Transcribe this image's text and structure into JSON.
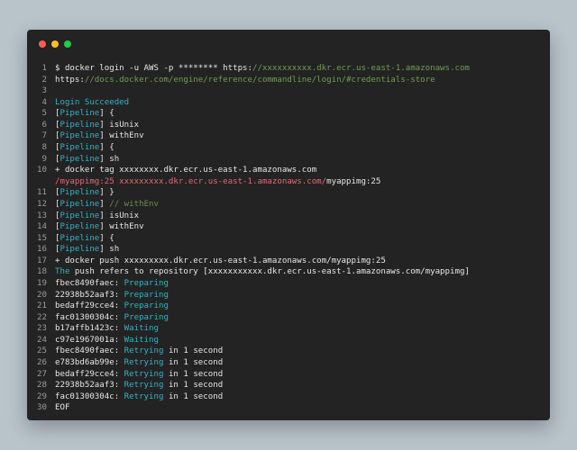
{
  "colors": {
    "background": "#b9c3ca",
    "window": "#232323",
    "close": "#ff5f57",
    "minimize": "#febc2e",
    "maximize": "#28c840",
    "default_text": "#e6e6e6",
    "line_number": "#9c9c9c",
    "cyan": "#33b3c8",
    "green_url": "#6f9f4f",
    "red_url": "#e06c75",
    "comment": "#6a8f53"
  },
  "window": {
    "buttons": [
      "close",
      "minimize",
      "maximize"
    ]
  },
  "lines": [
    {
      "n": "1",
      "segments": [
        {
          "t": "$ docker login -u AWS -p ******** https:",
          "c": "#e6e6e6"
        },
        {
          "t": "//xxxxxxxxxx.dkr.ecr.us-east-1.amazonaws.com",
          "c": "#6f9f4f"
        }
      ]
    },
    {
      "n": "2",
      "segments": [
        {
          "t": "https:",
          "c": "#e6e6e6"
        },
        {
          "t": "//docs.docker.com/engine/reference/commandline/login/#credentials-store",
          "c": "#6f9f4f"
        }
      ]
    },
    {
      "n": "3",
      "segments": []
    },
    {
      "n": "4",
      "segments": [
        {
          "t": "Login Succeeded",
          "c": "#33b3c8"
        }
      ]
    },
    {
      "n": "5",
      "segments": [
        {
          "t": "[",
          "c": "#e6e6e6"
        },
        {
          "t": "Pipeline",
          "c": "#33b3c8"
        },
        {
          "t": "] {",
          "c": "#e6e6e6"
        }
      ]
    },
    {
      "n": "6",
      "segments": [
        {
          "t": "[",
          "c": "#e6e6e6"
        },
        {
          "t": "Pipeline",
          "c": "#33b3c8"
        },
        {
          "t": "] isUnix",
          "c": "#e6e6e6"
        }
      ]
    },
    {
      "n": "7",
      "segments": [
        {
          "t": "[",
          "c": "#e6e6e6"
        },
        {
          "t": "Pipeline",
          "c": "#33b3c8"
        },
        {
          "t": "] withEnv",
          "c": "#e6e6e6"
        }
      ]
    },
    {
      "n": "8",
      "segments": [
        {
          "t": "[",
          "c": "#e6e6e6"
        },
        {
          "t": "Pipeline",
          "c": "#33b3c8"
        },
        {
          "t": "] {",
          "c": "#e6e6e6"
        }
      ]
    },
    {
      "n": "9",
      "segments": [
        {
          "t": "[",
          "c": "#e6e6e6"
        },
        {
          "t": "Pipeline",
          "c": "#33b3c8"
        },
        {
          "t": "] sh",
          "c": "#e6e6e6"
        }
      ]
    },
    {
      "n": "10",
      "segments": [
        {
          "t": "+ docker tag xxxxxxxx.dkr.ecr.us-east-1.amazonaws.com",
          "c": "#e6e6e6"
        }
      ]
    },
    {
      "n": "",
      "segments": [
        {
          "t": "/myappimg:25 xxxxxxxxx.dkr.ecr.us-east-1.amazonaws.com/",
          "c": "#e06c75"
        },
        {
          "t": "myappimg:25",
          "c": "#e6e6e6"
        }
      ]
    },
    {
      "n": "11",
      "segments": [
        {
          "t": "[",
          "c": "#e6e6e6"
        },
        {
          "t": "Pipeline",
          "c": "#33b3c8"
        },
        {
          "t": "] }",
          "c": "#e6e6e6"
        }
      ]
    },
    {
      "n": "12",
      "segments": [
        {
          "t": "[",
          "c": "#e6e6e6"
        },
        {
          "t": "Pipeline",
          "c": "#33b3c8"
        },
        {
          "t": "] ",
          "c": "#e6e6e6"
        },
        {
          "t": "// withEnv",
          "c": "#6a8f53"
        }
      ]
    },
    {
      "n": "13",
      "segments": [
        {
          "t": "[",
          "c": "#e6e6e6"
        },
        {
          "t": "Pipeline",
          "c": "#33b3c8"
        },
        {
          "t": "] isUnix",
          "c": "#e6e6e6"
        }
      ]
    },
    {
      "n": "14",
      "segments": [
        {
          "t": "[",
          "c": "#e6e6e6"
        },
        {
          "t": "Pipeline",
          "c": "#33b3c8"
        },
        {
          "t": "] withEnv",
          "c": "#e6e6e6"
        }
      ]
    },
    {
      "n": "15",
      "segments": [
        {
          "t": "[",
          "c": "#e6e6e6"
        },
        {
          "t": "Pipeline",
          "c": "#33b3c8"
        },
        {
          "t": "] {",
          "c": "#e6e6e6"
        }
      ]
    },
    {
      "n": "16",
      "segments": [
        {
          "t": "[",
          "c": "#e6e6e6"
        },
        {
          "t": "Pipeline",
          "c": "#33b3c8"
        },
        {
          "t": "] sh",
          "c": "#e6e6e6"
        }
      ]
    },
    {
      "n": "17",
      "segments": [
        {
          "t": "+ docker push xxxxxxxxx.dkr.ecr.us-east-1.amazonaws.com/myappimg:25",
          "c": "#e6e6e6"
        }
      ]
    },
    {
      "n": "18",
      "segments": [
        {
          "t": "The",
          "c": "#33b3c8"
        },
        {
          "t": " push refers to repository [xxxxxxxxxxx.dkr.ecr.us-east-1.amazonaws.com/myappimg]",
          "c": "#e6e6e6"
        }
      ]
    },
    {
      "n": "19",
      "segments": [
        {
          "t": "fbec8490faec: ",
          "c": "#e6e6e6"
        },
        {
          "t": "Preparing",
          "c": "#33b3c8"
        }
      ]
    },
    {
      "n": "20",
      "segments": [
        {
          "t": "22938b52aaf3: ",
          "c": "#e6e6e6"
        },
        {
          "t": "Preparing",
          "c": "#33b3c8"
        }
      ]
    },
    {
      "n": "21",
      "segments": [
        {
          "t": "bedaff29cce4: ",
          "c": "#e6e6e6"
        },
        {
          "t": "Preparing",
          "c": "#33b3c8"
        }
      ]
    },
    {
      "n": "22",
      "segments": [
        {
          "t": "fac01300304c: ",
          "c": "#e6e6e6"
        },
        {
          "t": "Preparing",
          "c": "#33b3c8"
        }
      ]
    },
    {
      "n": "23",
      "segments": [
        {
          "t": "b17affb1423c: ",
          "c": "#e6e6e6"
        },
        {
          "t": "Waiting",
          "c": "#33b3c8"
        }
      ]
    },
    {
      "n": "24",
      "segments": [
        {
          "t": "c97e1967001a: ",
          "c": "#e6e6e6"
        },
        {
          "t": "Waiting",
          "c": "#33b3c8"
        }
      ]
    },
    {
      "n": "25",
      "segments": [
        {
          "t": "fbec8490faec: ",
          "c": "#e6e6e6"
        },
        {
          "t": "Retrying",
          "c": "#33b3c8"
        },
        {
          "t": " in 1 second",
          "c": "#e6e6e6"
        }
      ]
    },
    {
      "n": "26",
      "segments": [
        {
          "t": "e783bd6ab99e: ",
          "c": "#e6e6e6"
        },
        {
          "t": "Retrying",
          "c": "#33b3c8"
        },
        {
          "t": " in 1 second",
          "c": "#e6e6e6"
        }
      ]
    },
    {
      "n": "27",
      "segments": [
        {
          "t": "bedaff29cce4: ",
          "c": "#e6e6e6"
        },
        {
          "t": "Retrying",
          "c": "#33b3c8"
        },
        {
          "t": " in 1 second",
          "c": "#e6e6e6"
        }
      ]
    },
    {
      "n": "28",
      "segments": [
        {
          "t": "22938b52aaf3: ",
          "c": "#e6e6e6"
        },
        {
          "t": "Retrying",
          "c": "#33b3c8"
        },
        {
          "t": " in 1 second",
          "c": "#e6e6e6"
        }
      ]
    },
    {
      "n": "29",
      "segments": [
        {
          "t": "fac01300304c: ",
          "c": "#e6e6e6"
        },
        {
          "t": "Retrying",
          "c": "#33b3c8"
        },
        {
          "t": " in 1 second",
          "c": "#e6e6e6"
        }
      ]
    },
    {
      "n": "30",
      "segments": [
        {
          "t": "EOF",
          "c": "#e6e6e6"
        }
      ]
    }
  ]
}
